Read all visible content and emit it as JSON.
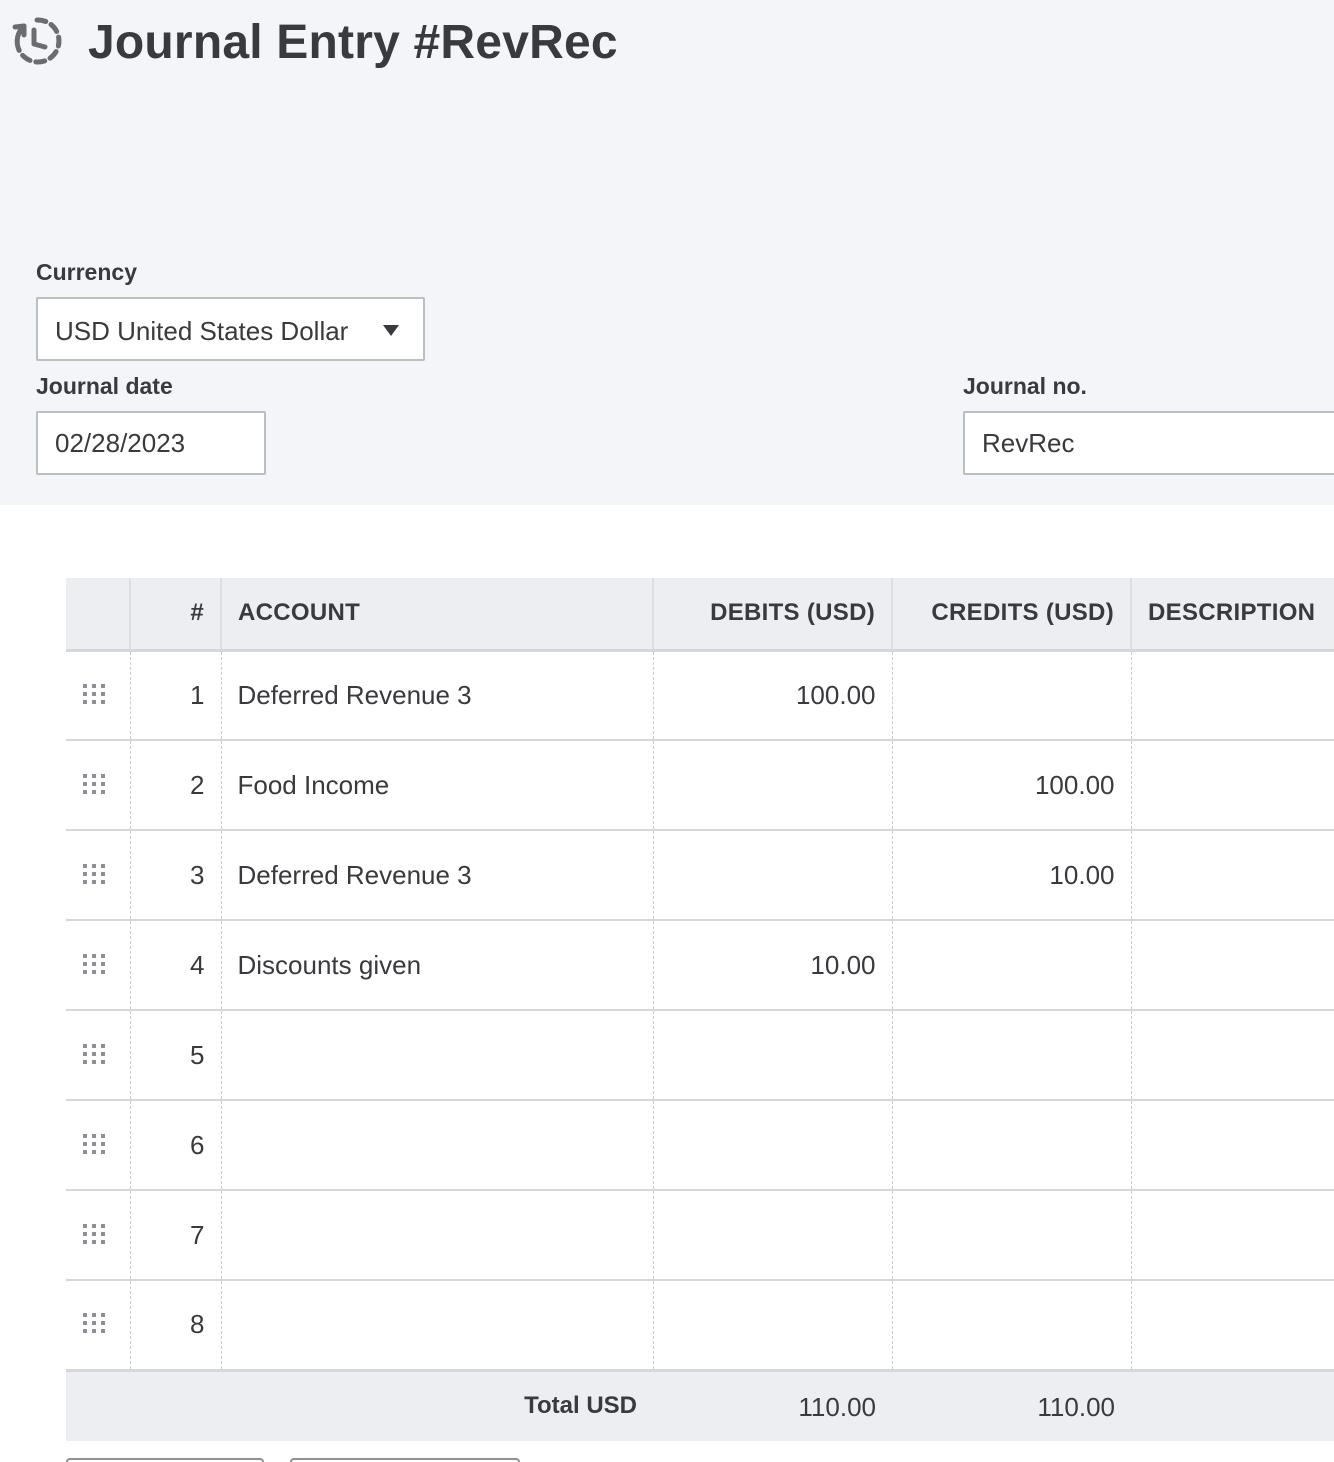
{
  "header": {
    "title": "Journal Entry #RevRec",
    "history_icon": "history-icon"
  },
  "form": {
    "currency_label": "Currency",
    "currency_value": "USD United States Dollar",
    "journal_date_label": "Journal date",
    "journal_date_value": "02/28/2023",
    "journal_no_label": "Journal no.",
    "journal_no_value": "RevRec"
  },
  "table": {
    "columns": [
      "#",
      "ACCOUNT",
      "DEBITS (USD)",
      "CREDITS (USD)",
      "DESCRIPTION"
    ],
    "rows": [
      {
        "num": "1",
        "account": "Deferred Revenue 3",
        "debit": "100.00",
        "credit": ""
      },
      {
        "num": "2",
        "account": "Food Income",
        "debit": "",
        "credit": "100.00"
      },
      {
        "num": "3",
        "account": "Deferred Revenue 3",
        "debit": "",
        "credit": "10.00"
      },
      {
        "num": "4",
        "account": "Discounts given",
        "debit": "10.00",
        "credit": ""
      },
      {
        "num": "5",
        "account": "",
        "debit": "",
        "credit": ""
      },
      {
        "num": "6",
        "account": "",
        "debit": "",
        "credit": ""
      },
      {
        "num": "7",
        "account": "",
        "debit": "",
        "credit": ""
      },
      {
        "num": "8",
        "account": "",
        "debit": "",
        "credit": ""
      }
    ],
    "total_label": "Total USD",
    "total_debits": "110.00",
    "total_credits": "110.00"
  },
  "colors": {
    "header_bg": "#f4f5f8",
    "text": "#393a3d",
    "border": "#babec5"
  }
}
